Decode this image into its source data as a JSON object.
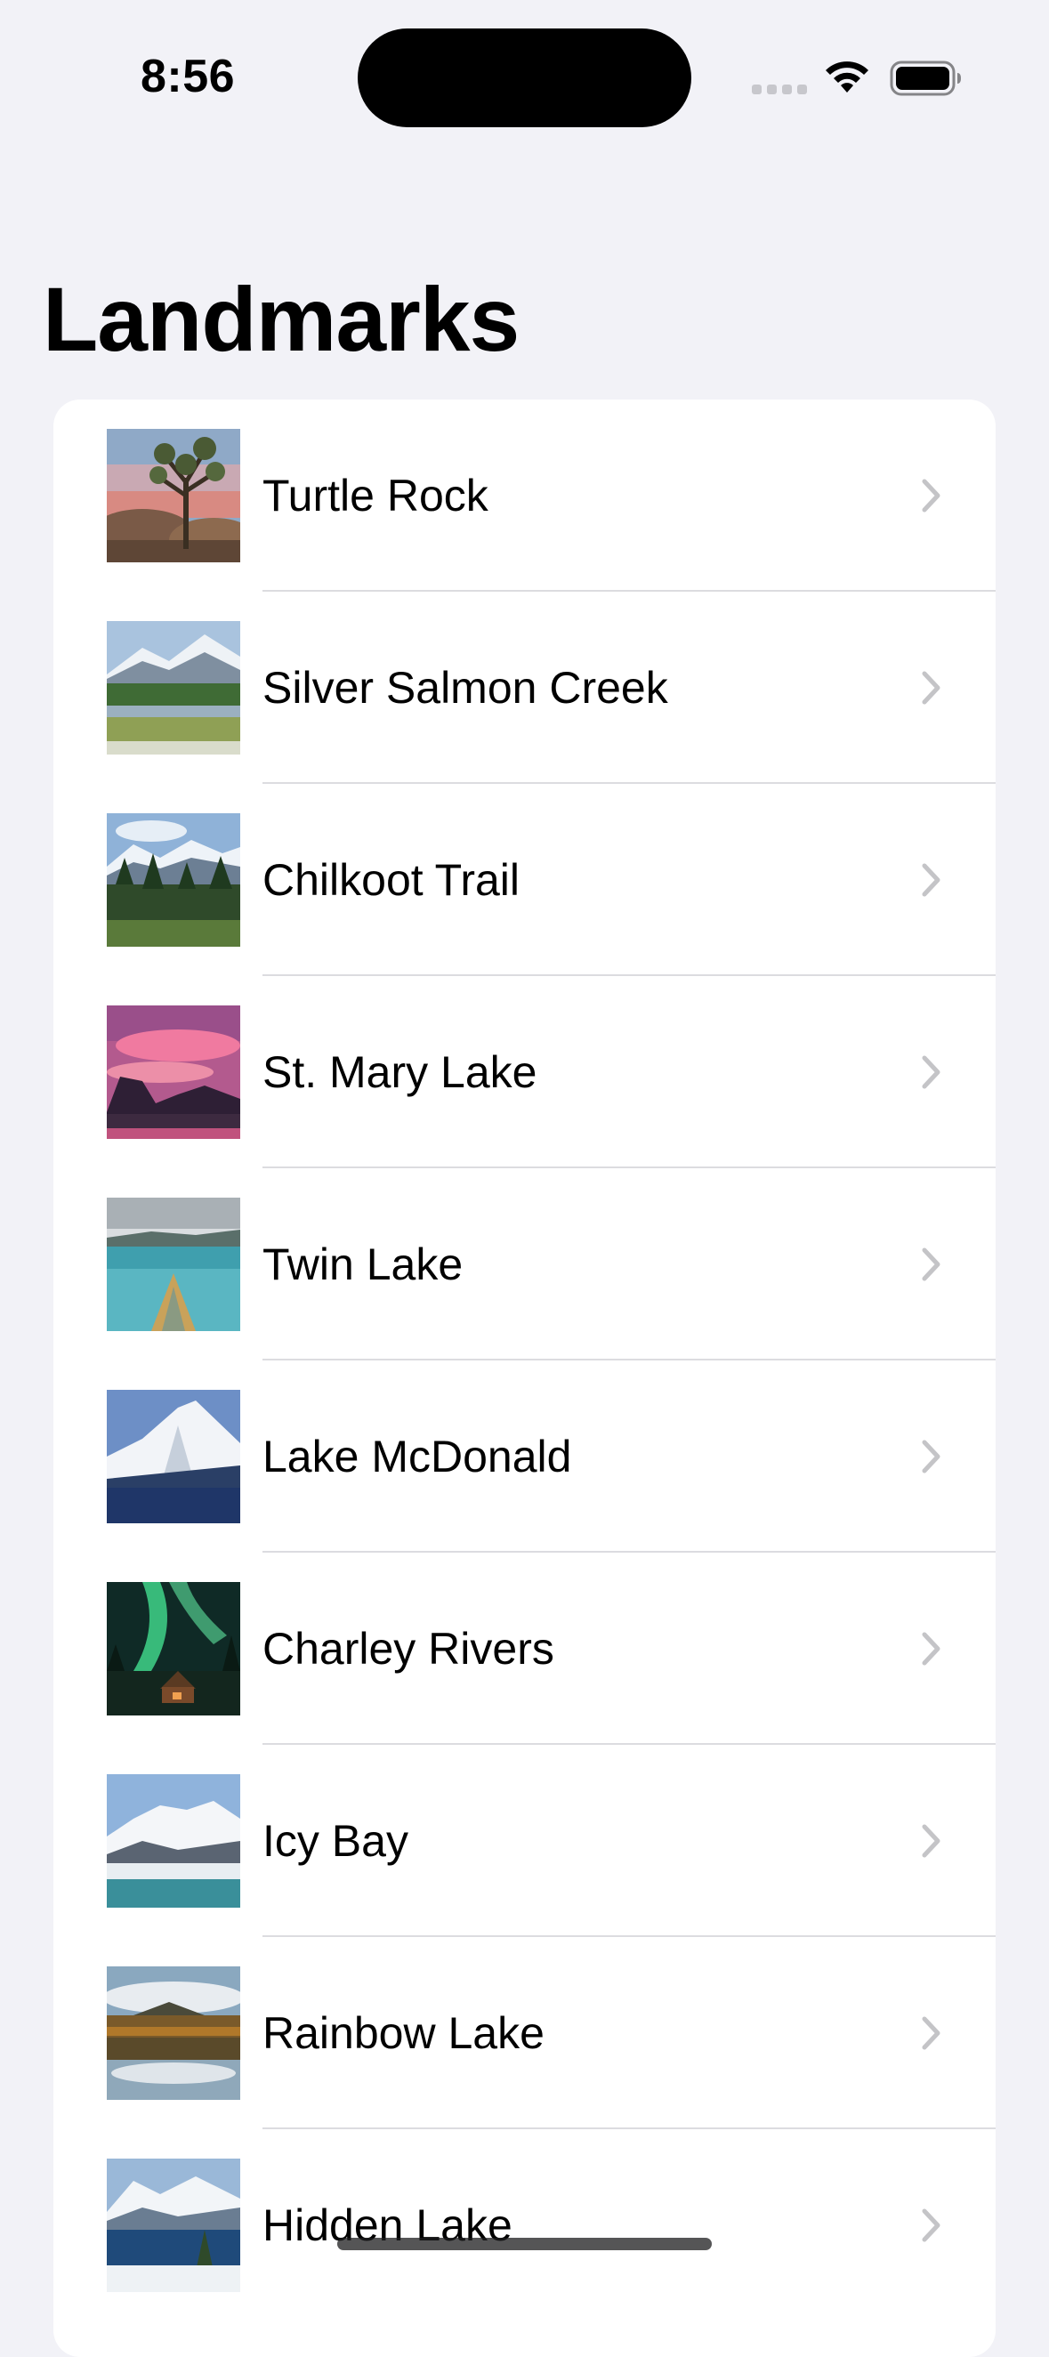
{
  "status_bar": {
    "time": "8:56",
    "icons": [
      "cellular-signal-icon",
      "wifi-icon",
      "battery-icon"
    ]
  },
  "nav": {
    "title": "Landmarks"
  },
  "landmarks": [
    {
      "name": "Turtle Rock",
      "thumbnail": "joshua-tree-desert-photo"
    },
    {
      "name": "Silver Salmon Creek",
      "thumbnail": "snowy-mountain-meadow-photo"
    },
    {
      "name": "Chilkoot Trail",
      "thumbnail": "mountain-forest-photo"
    },
    {
      "name": "St. Mary Lake",
      "thumbnail": "pink-sunset-lake-photo"
    },
    {
      "name": "Twin Lake",
      "thumbnail": "kayak-lake-photo"
    },
    {
      "name": "Lake McDonald",
      "thumbnail": "snow-peak-lake-photo"
    },
    {
      "name": "Charley Rivers",
      "thumbnail": "aurora-cabin-photo"
    },
    {
      "name": "Icy Bay",
      "thumbnail": "glacier-bay-photo"
    },
    {
      "name": "Rainbow Lake",
      "thumbnail": "forest-reflection-lake-photo"
    },
    {
      "name": "Hidden Lake",
      "thumbnail": "snowy-lake-tree-photo"
    }
  ],
  "colors": {
    "background": "#f2f2f7",
    "card": "#ffffff",
    "separator": "#dcdce0",
    "chevron": "#c4c4c7"
  }
}
